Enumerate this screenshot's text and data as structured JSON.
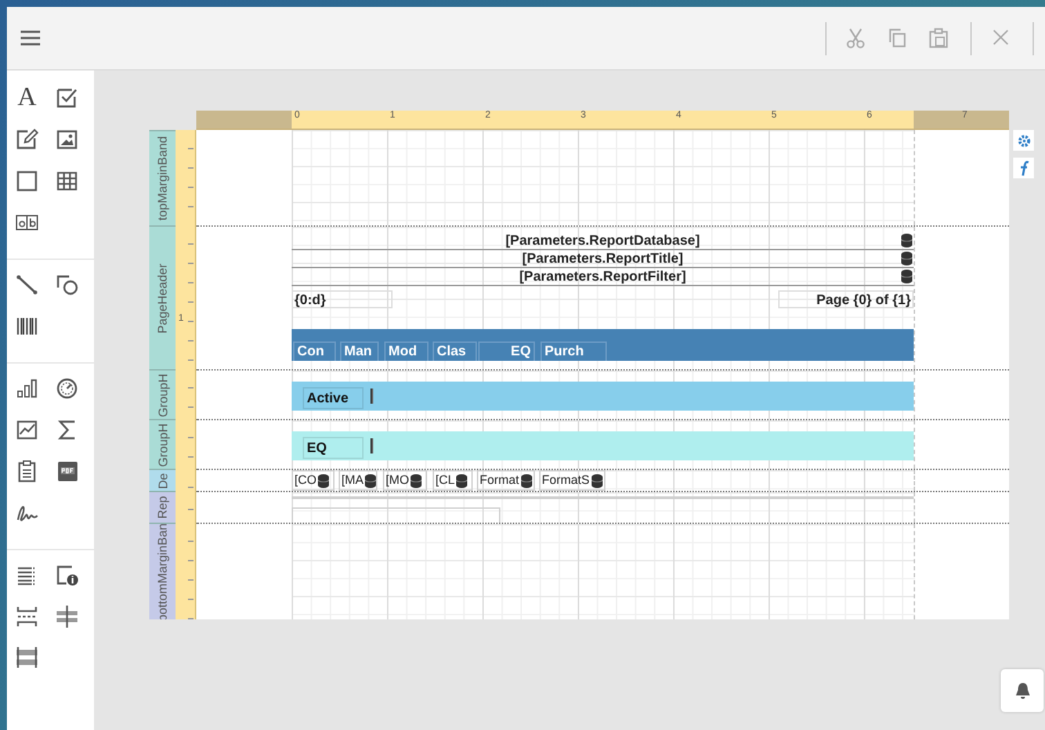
{
  "toolbox": {
    "text_tool_glyph": "A"
  },
  "toolbar": {
    "actions": [
      {
        "kind": "cut",
        "disabled": true
      },
      {
        "kind": "copy",
        "disabled": true
      },
      {
        "kind": "paste",
        "disabled": true
      },
      {
        "kind": "delete",
        "disabled": true
      }
    ]
  },
  "ruler": {
    "marks": [
      "0",
      "1",
      "2",
      "3",
      "4",
      "5",
      "6",
      "7"
    ]
  },
  "bands": [
    {
      "label": "topMarginBand",
      "kind": "margin",
      "color": "#aadcd6"
    },
    {
      "label": "PageHeader",
      "kind": "page_header",
      "color": "#aadcd6",
      "ruler_label": "1",
      "parameters": [
        "[Parameters.ReportDatabase]",
        "[Parameters.ReportTitle]",
        "[Parameters.ReportFilter]"
      ],
      "date_field": "{0:d}",
      "page_field": "Page {0} of {1}",
      "columns": [
        "Con",
        "Man",
        "Mod",
        "Clas",
        "EQ",
        "Purch"
      ]
    },
    {
      "label": "GroupH",
      "kind": "group_header",
      "color": "#aadcd6",
      "group_bar": {
        "field": "Active",
        "color": "#87ceeb"
      }
    },
    {
      "label": "GroupH",
      "kind": "group_header",
      "color": "#aadcd6",
      "group_bar": {
        "field": "EQ",
        "color": "#afeeee"
      }
    },
    {
      "label": "De",
      "kind": "detail",
      "color": "#b0dcec",
      "cells": [
        "[CO",
        "[MA",
        "[MO",
        "[CL",
        "Format",
        "FormatS"
      ]
    },
    {
      "label": "Rep",
      "kind": "footer",
      "color": "#c5cae8"
    },
    {
      "label": "bottomMarginBan",
      "kind": "margin",
      "color": "#c5cae8"
    }
  ]
}
